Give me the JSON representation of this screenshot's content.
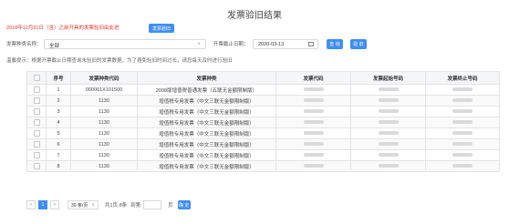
{
  "title": "发票验旧结果",
  "notice": "2018年12月31日（含）之前开具的发票验旧由此进",
  "toggle_button": "发票验旧",
  "filters": {
    "type_label": "发票种类名称：",
    "type_value": "全部",
    "date_label": "开票截止日期：",
    "date_value": "2020-03-13",
    "search_button": "查 询",
    "export_button": "验 旧"
  },
  "tip": "温馨提示：根据开票截止日期查询未验旧的发票数据，为了避免验旧时间过长，请您每天及时进行验旧",
  "table": {
    "headers": [
      "",
      "序号",
      "发票种类代码",
      "发票种类",
      "发票代码",
      "发票起始号码",
      "发票终止号码"
    ],
    "rows": [
      {
        "index": "1",
        "code": "000001X101500",
        "type": "2008版增值税普通发票（五联无金额限制版）"
      },
      {
        "index": "2",
        "code": "1130",
        "type": "增值税专用发票（中文三联无金额限制版）"
      },
      {
        "index": "3",
        "code": "1130",
        "type": "增值税专用发票（中文三联无金额限制版）"
      },
      {
        "index": "4",
        "code": "1130",
        "type": "增值税专用发票（中文三联无金额限制版）"
      },
      {
        "index": "5",
        "code": "1130",
        "type": "增值税专用发票（中文三联无金额限制版）"
      },
      {
        "index": "6",
        "code": "1130",
        "type": "增值税专用发票（中文三联无金额限制版）"
      },
      {
        "index": "7",
        "code": "1130",
        "type": "增值税专用发票（中文三联无金额限制版）"
      },
      {
        "index": "8",
        "code": "1130",
        "type": "增值税专用发票（中文三联无金额限制版）"
      }
    ]
  },
  "pagination": {
    "prev": "<",
    "page": "1",
    "next": ">",
    "page_size": "30 条/页",
    "total_text": "共1页,8条",
    "goto_label": "到第",
    "goto_suffix": "页",
    "confirm": "确 定"
  },
  "colors": {
    "accent": "#3f8ef0",
    "notice": "#e6352b"
  }
}
